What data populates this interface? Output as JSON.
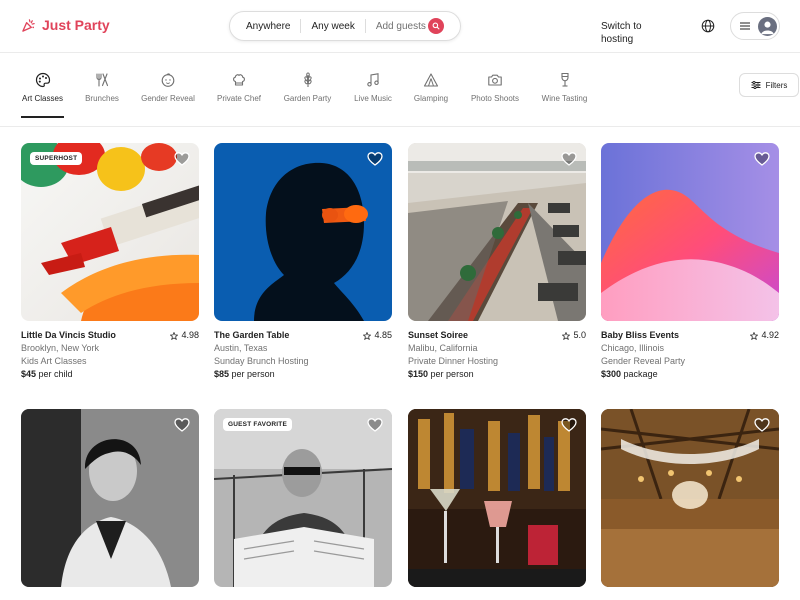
{
  "brand": {
    "name": "Just Party",
    "color": "#e0435a"
  },
  "search": {
    "where": "Anywhere",
    "when": "Any week",
    "guests": "Add guests"
  },
  "header": {
    "switch_line1": "Switch to",
    "switch_line2": "hosting"
  },
  "categories": [
    {
      "label": "Art Classes",
      "icon": "palette-icon",
      "active": true
    },
    {
      "label": "Brunches",
      "icon": "utensils-icon"
    },
    {
      "label": "Gender Reveal",
      "icon": "baby-face-icon"
    },
    {
      "label": "Private Chef",
      "icon": "chef-hat-icon"
    },
    {
      "label": "Garden Party",
      "icon": "wheat-icon"
    },
    {
      "label": "Live Music",
      "icon": "music-note-icon"
    },
    {
      "label": "Glamping",
      "icon": "tent-icon"
    },
    {
      "label": "Photo Shoots",
      "icon": "camera-icon"
    },
    {
      "label": "Wine Tasting",
      "icon": "wine-glass-icon"
    }
  ],
  "filters_label": "Filters",
  "listings": [
    {
      "badge": "SUPERHOST",
      "name": "Little Da Vincis Studio",
      "rating": "4.98",
      "location": "Brooklyn, New York",
      "category": "Kids Art Classes",
      "price": "$45",
      "unit": "per child"
    },
    {
      "badge": "",
      "name": "The Garden Table",
      "rating": "4.85",
      "location": "Austin, Texas",
      "category": "Sunday Brunch Hosting",
      "price": "$85",
      "unit": "per person"
    },
    {
      "badge": "",
      "name": "Sunset Soiree",
      "rating": "5.0",
      "location": "Malibu, California",
      "category": "Private Dinner Hosting",
      "price": "$150",
      "unit": "per person"
    },
    {
      "badge": "",
      "name": "Baby Bliss Events",
      "rating": "4.92",
      "location": "Chicago, Illinois",
      "category": "Gender Reveal Party",
      "price": "$300",
      "unit": "package"
    },
    {
      "badge": "",
      "name": "",
      "rating": "",
      "location": "",
      "category": "",
      "price": "",
      "unit": ""
    },
    {
      "badge": "GUEST FAVORITE",
      "name": "",
      "rating": "",
      "location": "",
      "category": "",
      "price": "",
      "unit": ""
    },
    {
      "badge": "",
      "name": "",
      "rating": "",
      "location": "",
      "category": "",
      "price": "",
      "unit": ""
    },
    {
      "badge": "",
      "name": "",
      "rating": "",
      "location": "",
      "category": "",
      "price": "",
      "unit": ""
    }
  ]
}
